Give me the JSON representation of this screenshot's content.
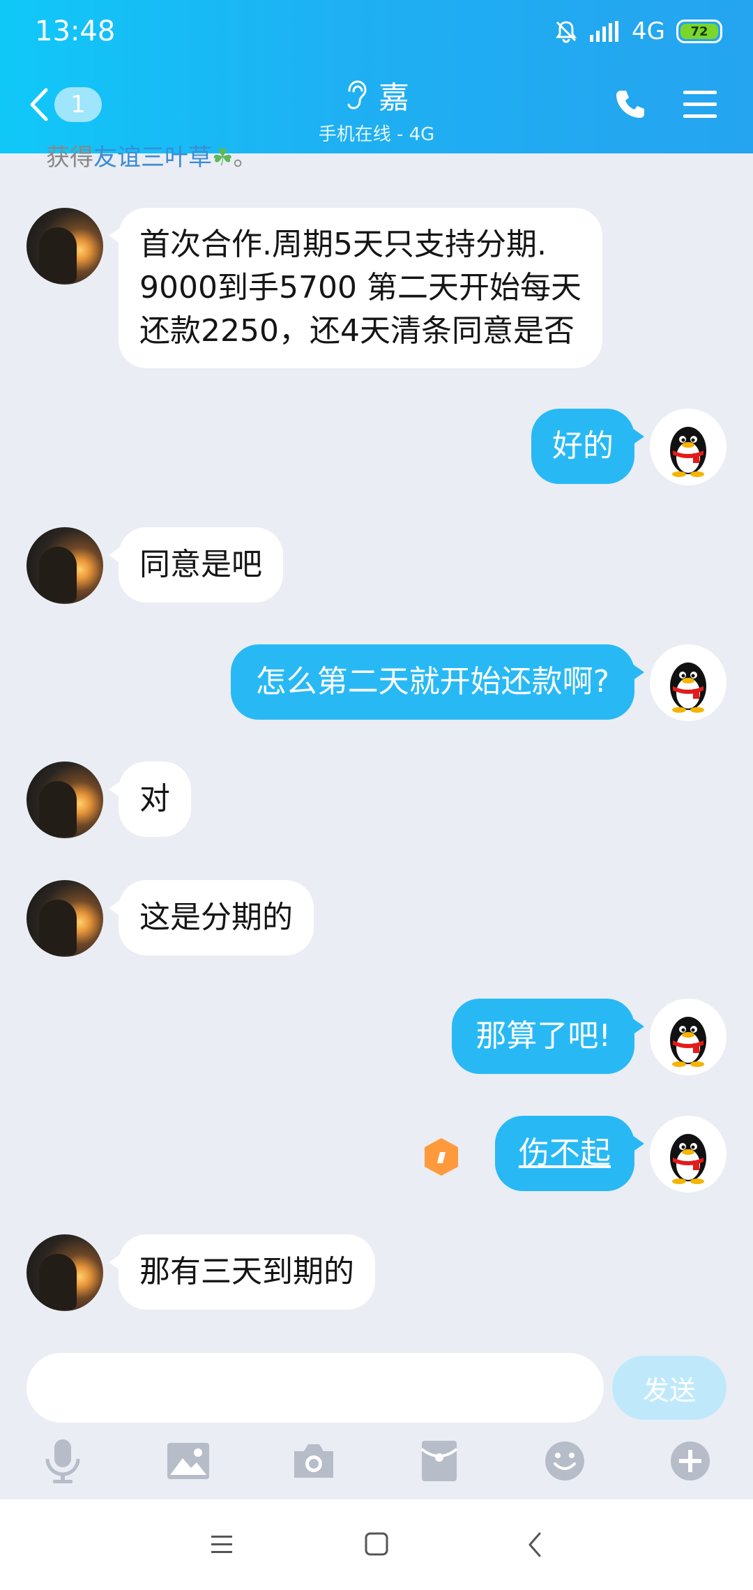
{
  "status": {
    "time": "13:48",
    "network": "4G",
    "battery": "72"
  },
  "header": {
    "back_count": "1",
    "title": "嘉",
    "subtitle": "手机在线 - 4G"
  },
  "partial_text": {
    "prefix": "获得",
    "link": "友谊三叶草",
    "suffix": "。"
  },
  "messages": [
    {
      "side": "in",
      "text": "首次合作.周期5天只支持分期.\n9000到手5700 第二天开始每天\n还款2250，还4天清条同意是否"
    },
    {
      "side": "out",
      "text": "好的"
    },
    {
      "side": "in",
      "text": "同意是吧"
    },
    {
      "side": "out",
      "text": "怎么第二天就开始还款啊?"
    },
    {
      "side": "in",
      "text": "对"
    },
    {
      "side": "in",
      "text": "这是分期的"
    },
    {
      "side": "out",
      "text": "那算了吧!"
    },
    {
      "side": "out",
      "text": "伤不起"
    },
    {
      "side": "in",
      "text": "那有三天到期的"
    }
  ],
  "input": {
    "value": "",
    "placeholder": ""
  },
  "send_label": "发送",
  "colors": {
    "header_start": "#10c8f8",
    "header_end": "#25a4ef",
    "out_bubble": "#28b9f5",
    "in_bubble": "#ffffff",
    "chat_bg": "#eaedf4",
    "send_disabled": "#bfe9fb",
    "toolbar_icon": "#b6bcc8"
  },
  "toolbar_icons": [
    "microphone-icon",
    "image-icon",
    "camera-icon",
    "red-packet-icon",
    "emoji-icon",
    "plus-icon"
  ],
  "nav_icons": [
    "recent-apps-icon",
    "home-icon",
    "back-icon"
  ]
}
